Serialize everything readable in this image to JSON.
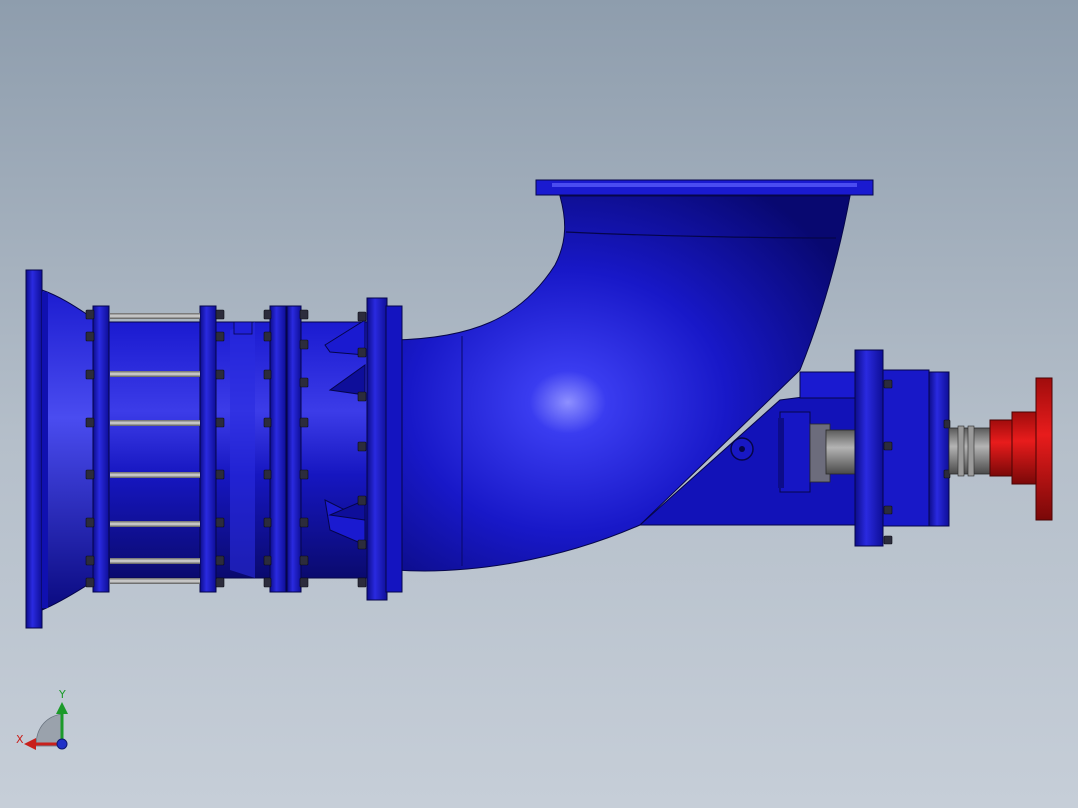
{
  "viewport": {
    "background_top": "#8e9dad",
    "background_bottom": "#c6ced8"
  },
  "model": {
    "body_color": "#1414c8",
    "body_highlight": "#5a5cf0",
    "body_shadow": "#0a0a78",
    "shaft_color": "#8a8a8a",
    "coupling_color": "#d01414",
    "bolt_color": "#2c2c3c"
  },
  "triad": {
    "x_label": "X",
    "y_label": "Y",
    "x_color": "#c8201c",
    "y_color": "#1c9a2a",
    "z_color": "#2030c8"
  }
}
